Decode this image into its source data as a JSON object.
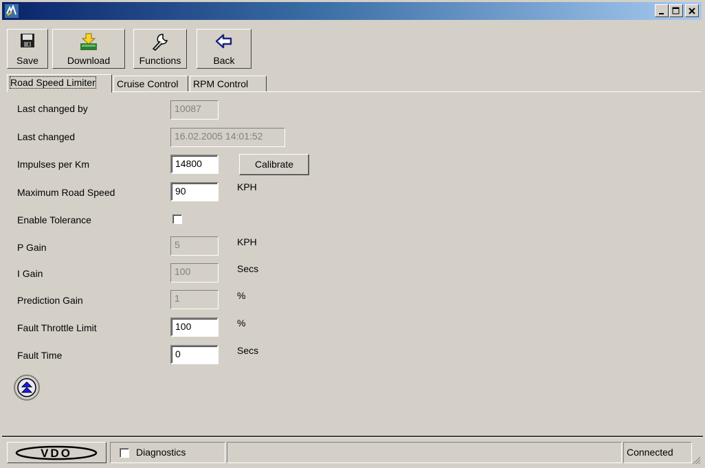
{
  "toolbar": {
    "save": "Save",
    "download": "Download",
    "functions": "Functions",
    "back": "Back"
  },
  "tabs": [
    "Road Speed Limiter",
    "Cruise Control",
    "RPM Control"
  ],
  "form": {
    "last_changed_by": {
      "label": "Last changed by",
      "value": "10087"
    },
    "last_changed": {
      "label": "Last changed",
      "value": "16.02.2005 14:01:52"
    },
    "impulses": {
      "label": "Impulses per Km",
      "value": "14800",
      "button": "Calibrate"
    },
    "max_speed": {
      "label": "Maximum Road Speed",
      "value": "90",
      "unit": "KPH"
    },
    "enable_tolerance": {
      "label": "Enable Tolerance",
      "checked": false
    },
    "p_gain": {
      "label": "P Gain",
      "value": "5",
      "unit": "KPH"
    },
    "i_gain": {
      "label": "I Gain",
      "value": "100",
      "unit": "Secs"
    },
    "prediction_gain": {
      "label": "Prediction Gain",
      "value": "1",
      "unit": "%"
    },
    "fault_throttle": {
      "label": "Fault Throttle Limit",
      "value": "100",
      "unit": "%"
    },
    "fault_time": {
      "label": "Fault Time",
      "value": "0",
      "unit": "Secs"
    }
  },
  "statusbar": {
    "logo": "VDO",
    "diagnostics": "Diagnostics",
    "connection": "Connected"
  },
  "icons": {
    "app": "app-icon",
    "save": "floppy-disk-icon",
    "download": "download-icon",
    "functions": "wrench-icon",
    "back": "back-arrow-icon",
    "collapse": "double-chevron-up-icon"
  },
  "colors": {
    "title_start": "#0a246a",
    "title_end": "#a6caf0",
    "window": "#d4d0c8"
  }
}
